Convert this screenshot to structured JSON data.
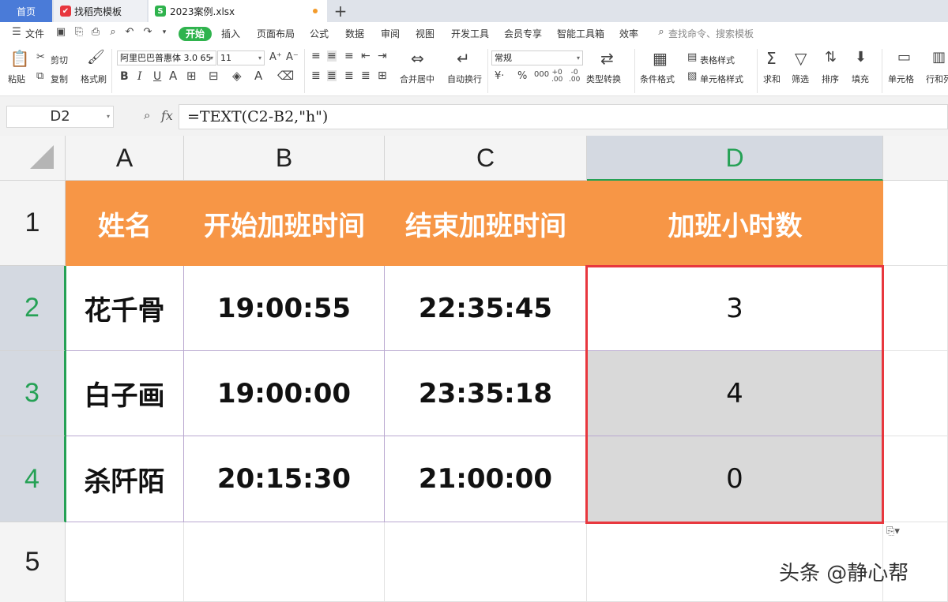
{
  "tabs": {
    "home": "首页",
    "template": "找稻壳模板",
    "file": "2023案例.xlsx",
    "add": "+"
  },
  "menu": {
    "file": "文件",
    "items": [
      "开始",
      "插入",
      "页面布局",
      "公式",
      "数据",
      "审阅",
      "视图",
      "开发工具",
      "会员专享",
      "智能工具箱",
      "效率"
    ],
    "search_placeholder": "查找命令、搜索模板"
  },
  "ribbon": {
    "paste": "粘贴",
    "cut": "剪切",
    "copy": "复制",
    "format_painter": "格式刷",
    "font_name": "阿里巴巴普惠体 3.0 65",
    "font_size": "11",
    "merge": "合并居中",
    "wrap": "自动换行",
    "number_format": "常规",
    "type_convert": "类型转换",
    "cond_format": "条件格式",
    "table_style": "表格样式",
    "cell_style": "单元格样式",
    "sum": "求和",
    "filter": "筛选",
    "sort": "排序",
    "fill": "填充",
    "cell": "单元格",
    "rowcol": "行和列"
  },
  "formula_bar": {
    "name_box": "D2",
    "fx": "fx",
    "formula": "=TEXT(C2-B2,\"h\")"
  },
  "sheet": {
    "columns": [
      "A",
      "B",
      "C",
      "D"
    ],
    "rows": [
      "1",
      "2",
      "3",
      "4",
      "5"
    ],
    "header": [
      "姓名",
      "开始加班时间",
      "结束加班时间",
      "加班小时数"
    ],
    "data": [
      [
        "花千骨",
        "19:00:55",
        "22:35:45",
        "3"
      ],
      [
        "白子画",
        "19:00:00",
        "23:35:18",
        "4"
      ],
      [
        "杀阡陌",
        "20:15:30",
        "21:00:00",
        "0"
      ]
    ]
  },
  "watermark": "头条 @静心帮",
  "colors": {
    "header_fill": "#f79646",
    "selection_border": "#e8373e",
    "accent_green": "#25a155",
    "tab_blue": "#4a7bd8"
  }
}
